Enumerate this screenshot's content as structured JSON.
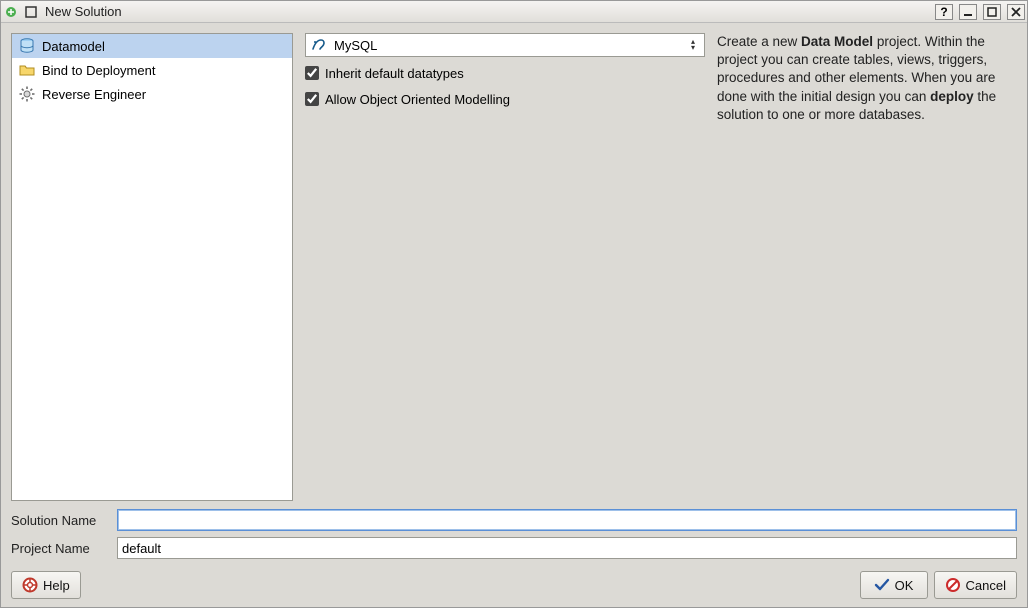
{
  "window": {
    "title": "New Solution"
  },
  "sidebar": {
    "items": [
      {
        "label": "Datamodel",
        "selected": true
      },
      {
        "label": "Bind to Deployment",
        "selected": false
      },
      {
        "label": "Reverse Engineer",
        "selected": false
      }
    ]
  },
  "config": {
    "db_dropdown": {
      "selected": "MySQL"
    },
    "checkboxes": [
      {
        "label": "Inherit default datatypes",
        "checked": true
      },
      {
        "label": "Allow Object Oriented Modelling",
        "checked": true
      }
    ]
  },
  "description": {
    "line1_pre": "Create a new ",
    "line1_bold": "Data Model",
    "line1_post": " project. Within the project you can create tables, views, triggers, procedures and other elements. When you are done with the initial design you can ",
    "line2_bold": "deploy",
    "line2_post": " the solution to one or more databases."
  },
  "form": {
    "solution_label": "Solution Name",
    "solution_value": "",
    "project_label": "Project Name",
    "project_value": "default"
  },
  "buttons": {
    "help": "Help",
    "ok": "OK",
    "cancel": "Cancel"
  }
}
